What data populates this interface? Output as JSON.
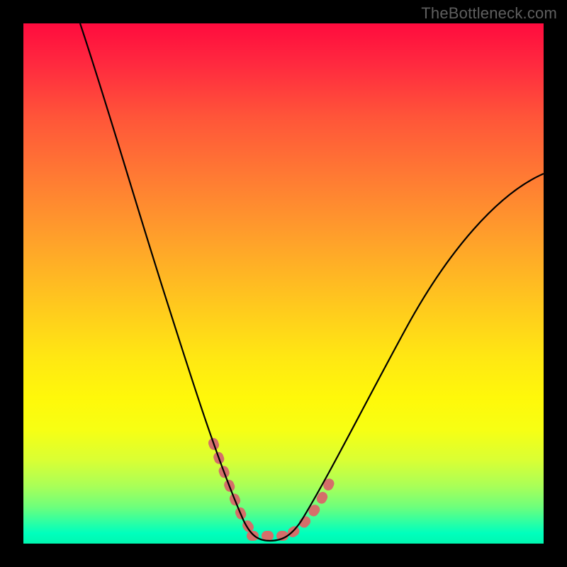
{
  "watermark": {
    "text": "TheBottleneck.com"
  },
  "colors": {
    "frame": "#000000",
    "watermark_text": "#5f5f5f",
    "curve": "#000000",
    "highlight": "#d46e6a",
    "gradient_top": "#ff0b3e",
    "gradient_bottom": "#00f7b0"
  },
  "chart_data": {
    "type": "line",
    "title": "",
    "xlabel": "",
    "ylabel": "",
    "xlim": [
      0,
      100
    ],
    "ylim": [
      0,
      100
    ],
    "grid": false,
    "series": [
      {
        "name": "bottleneck-curve",
        "x": [
          11,
          15,
          20,
          25,
          30,
          35,
          38,
          40,
          42,
          44,
          46,
          48,
          50,
          55,
          60,
          65,
          70,
          75,
          80,
          85,
          90,
          95,
          100
        ],
        "y": [
          100,
          86,
          71,
          56,
          42,
          28,
          19,
          12,
          7,
          4,
          2,
          2,
          2,
          4,
          8,
          14,
          22,
          31,
          41,
          51,
          61,
          70,
          71
        ]
      },
      {
        "name": "optimal-range-highlight",
        "x": [
          38,
          40,
          42,
          44,
          46,
          48,
          50,
          52,
          54
        ],
        "y": [
          19,
          12,
          7,
          4,
          2,
          2,
          2,
          3,
          5
        ]
      }
    ],
    "annotations": [
      {
        "text": "TheBottleneck.com",
        "role": "watermark",
        "position": "top-right"
      }
    ]
  }
}
